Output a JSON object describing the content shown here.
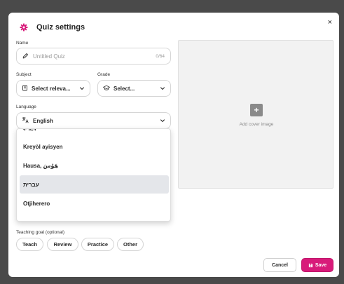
{
  "dialog": {
    "title": "Quiz settings",
    "close_glyph": "×",
    "accent_color": "#d81b7a"
  },
  "name": {
    "label": "Name",
    "placeholder": "Untitled Quiz",
    "counter": "0/64"
  },
  "subject": {
    "label": "Subject",
    "value": "Select releva..."
  },
  "grade": {
    "label": "Grade",
    "value": "Select..."
  },
  "language": {
    "label": "Language",
    "value": "English",
    "options": [
      {
        "label": "ትግርኛ",
        "highlighted": false,
        "partially_visible": true
      },
      {
        "label": "Kreyòl ayisyen",
        "highlighted": false
      },
      {
        "label": "Hausa, هَوُسَ",
        "highlighted": false
      },
      {
        "label": "עברית",
        "highlighted": true
      },
      {
        "label": "Otjiherero",
        "highlighted": false
      }
    ]
  },
  "cover": {
    "plus_glyph": "+",
    "label": "Add cover image"
  },
  "teaching_goal": {
    "label": "Teaching goal (optional)",
    "chips": [
      "Teach",
      "Review",
      "Practice",
      "Other"
    ]
  },
  "footer": {
    "cancel_label": "Cancel",
    "save_label": "Save"
  },
  "icons": {
    "title": "gear-icon",
    "name_field": "pencil-icon",
    "subject": "book-icon",
    "grade": "graduation-cap-icon",
    "language": "translate-icon",
    "dropdown": "chevron-down-icon",
    "save": "floppy-disk-icon"
  }
}
